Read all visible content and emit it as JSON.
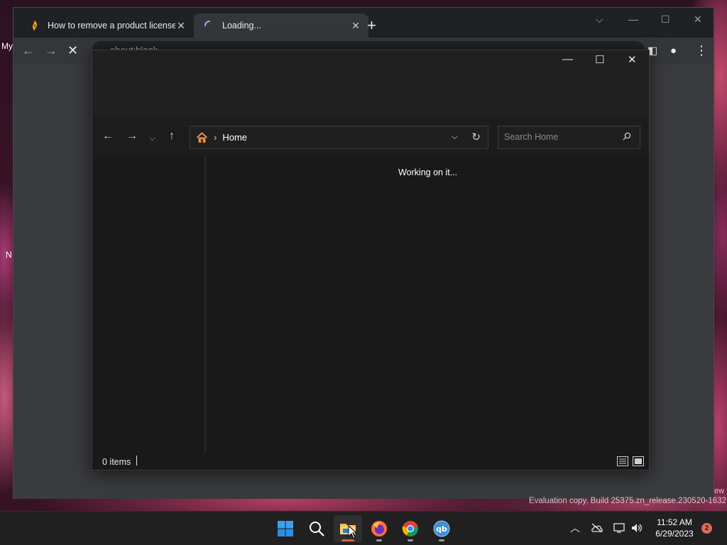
{
  "desktop": {
    "frag_my": "My",
    "frag_n": "N",
    "frag_ew": "ew"
  },
  "browser": {
    "tabs": [
      {
        "title": "How to remove a product license",
        "favicon": "fl-studio-icon",
        "active": false
      },
      {
        "title": "Loading...",
        "favicon": "loading-spinner-icon",
        "active": true
      }
    ],
    "omnibox_text": "about:blank"
  },
  "explorer": {
    "address": {
      "location": "Home"
    },
    "search": {
      "placeholder": "Search Home"
    },
    "content_message": "Working on it...",
    "status": {
      "item_count": "0 items"
    }
  },
  "watermark": "Evaluation copy. Build 25375.zn_release.230520-1632",
  "taskbar": {
    "apps": [
      "start-button",
      "search-button",
      "file-explorer",
      "firefox",
      "chrome",
      "qbittorrent"
    ],
    "active_app": "file-explorer",
    "clock": {
      "time": "11:52 AM",
      "date": "6/29/2023"
    },
    "notification_count": "2"
  },
  "colors": {
    "accent_pill": "#e05a4a",
    "explorer_bg": "#191919",
    "taskbar_bg": "#202020"
  }
}
